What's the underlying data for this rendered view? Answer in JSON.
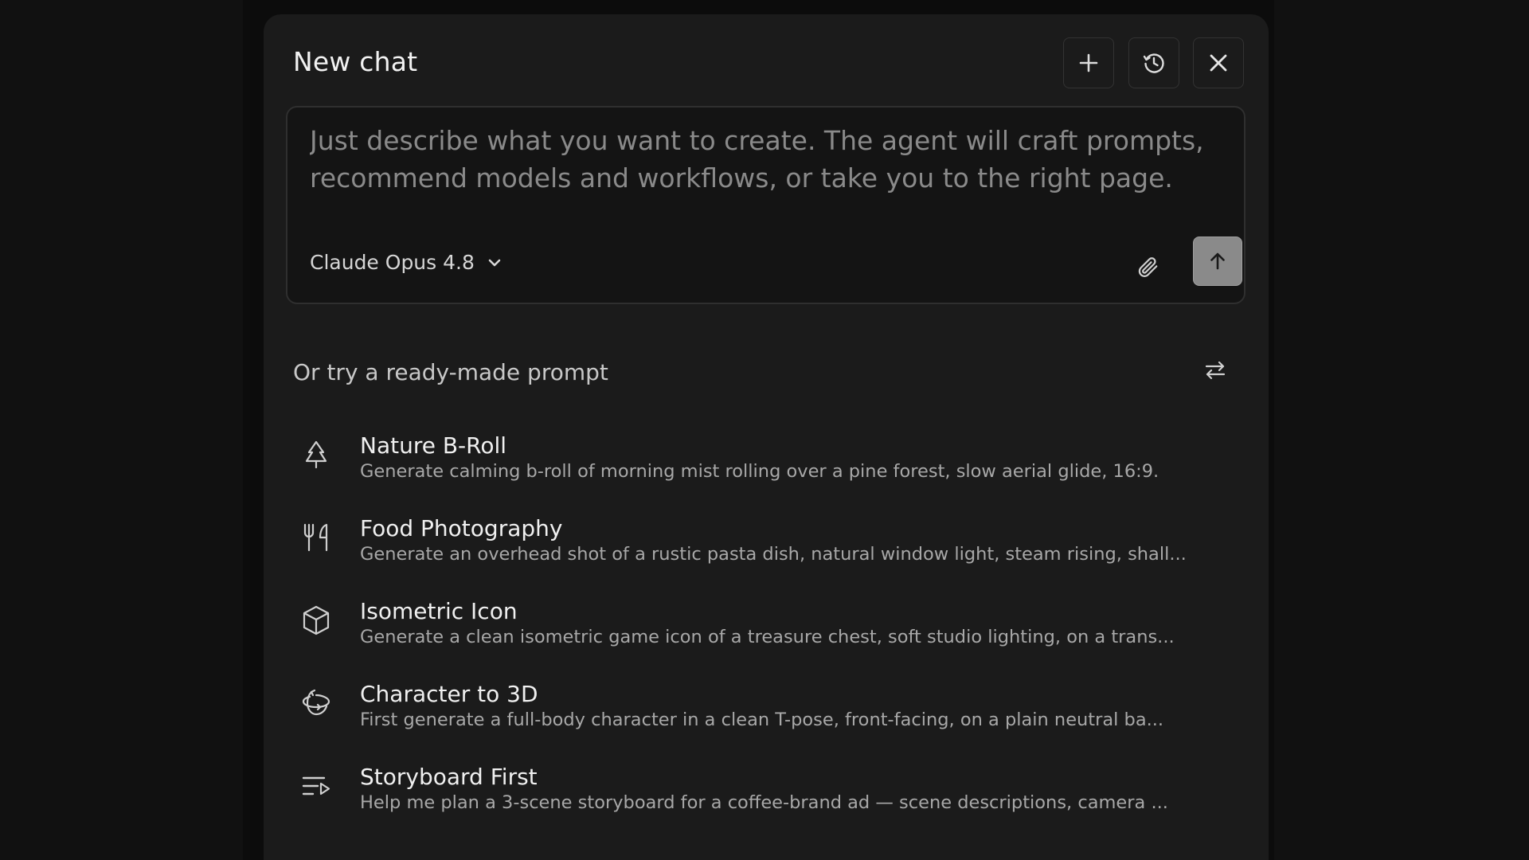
{
  "header": {
    "title": "New chat",
    "actions": [
      {
        "name": "new-chat-button",
        "icon": "plus-icon"
      },
      {
        "name": "history-button",
        "icon": "history-icon"
      },
      {
        "name": "close-button",
        "icon": "close-icon"
      }
    ]
  },
  "composer": {
    "placeholder": "Just describe what you want to create. The agent will craft prompts, recommend models and workflows, or take you to the right page.",
    "model": "Claude Opus 4.8",
    "model_icon": "chevron-down-icon",
    "attach_icon": "paperclip-icon",
    "send_icon": "arrow-up-icon"
  },
  "suggestions": {
    "heading": "Or try a ready-made prompt",
    "shuffle_icon": "shuffle-icon",
    "items": [
      {
        "icon": "tree-icon",
        "title": "Nature B-Roll",
        "description": "Generate calming b-roll of morning mist rolling over a pine forest, slow aerial glide, 16:9."
      },
      {
        "icon": "fork-knife-icon",
        "title": "Food Photography",
        "description": "Generate an overhead shot of a rustic pasta dish, natural window light, steam rising, shall..."
      },
      {
        "icon": "cube-icon",
        "title": "Isometric Icon",
        "description": "Generate a clean isometric game icon of a treasure chest, soft studio lighting, on a trans..."
      },
      {
        "icon": "rotate-3d-icon",
        "title": "Character to 3D",
        "description": "First generate a full-body character in a clean T-pose, front-facing, on a plain neutral ba..."
      },
      {
        "icon": "list-video-icon",
        "title": "Storyboard First",
        "description": "Help me plan a 3-scene storyboard for a coffee-brand ad — scene descriptions, camera ..."
      }
    ]
  },
  "colors": {
    "background": "#0c0c0c",
    "panel": "#1b1b1b",
    "composer": "#141414",
    "send_button": "#8a8a8a",
    "text_primary": "#f0f0f0",
    "text_secondary": "#a8a8a8"
  }
}
